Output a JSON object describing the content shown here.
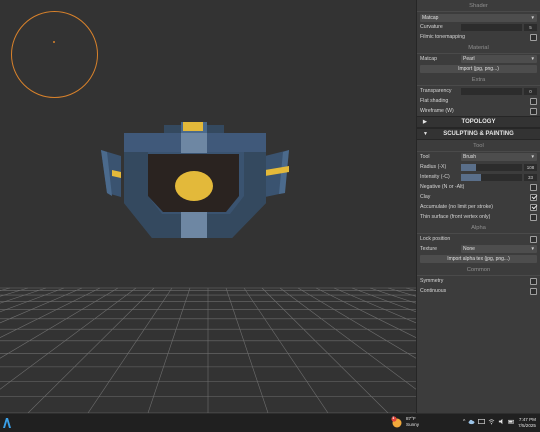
{
  "panel": {
    "shader": {
      "title": "Shader",
      "shader_value": "Matcap",
      "curvature_label": "Curvature",
      "curvature_value": "5",
      "filmic_label": "Filmic tonemapping"
    },
    "material": {
      "title": "Material",
      "matcap_label": "Matcap",
      "matcap_value": "Pearl",
      "import_label": "Import (jpg, png...)"
    },
    "extra": {
      "title": "Extra",
      "transparency_label": "Transparency",
      "transparency_value": "0",
      "flat_label": "Flat shading",
      "wireframe_label": "Wireframe (W)"
    },
    "topology_label": "TOPOLOGY",
    "sculpting_label": "SCULPTING & PAINTING",
    "tool": {
      "title": "Tool",
      "tool_label": "Tool",
      "tool_value": "Brush",
      "radius_label": "Radius (-X)",
      "radius_value": "108",
      "radius_fraction": 0.25,
      "intensity_label": "Intensity (-C)",
      "intensity_value": "33",
      "intensity_fraction": 0.33,
      "negative_label": "Negative (N or -Alt)",
      "clay_label": "Clay",
      "accumulate_label": "Accumulate (no limit per stroke)",
      "thin_label": "Thin surface (front vertex only)"
    },
    "alpha": {
      "title": "Alpha",
      "lock_label": "Lock position",
      "texture_label": "Texture",
      "texture_value": "None",
      "import_label": "Import alpha tex (jpg, png...)"
    },
    "common": {
      "title": "Common",
      "symmetry_label": "Symmetry",
      "continuous_label": "Continuous"
    }
  },
  "taskbar": {
    "weather_temp": "87°F",
    "weather_cond": "Sunny",
    "weather_badge": "1",
    "time": "7:47 PM",
    "date": "7/5/2025"
  },
  "colors": {
    "accent_orange": "#d9822b",
    "model_blue": "#3a5370",
    "model_dark": "#2a2320",
    "model_yellow": "#e3b93a"
  }
}
